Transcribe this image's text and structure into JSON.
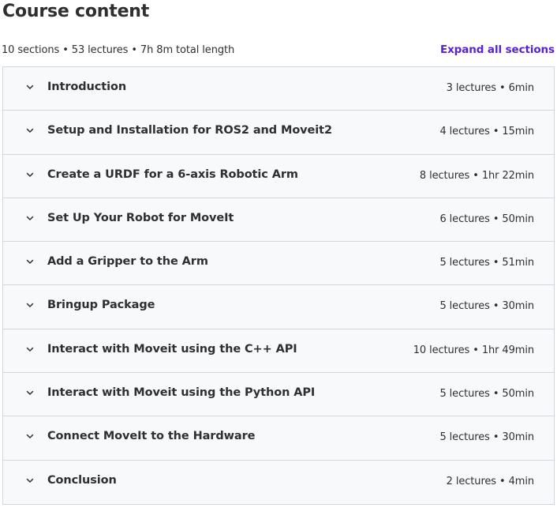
{
  "header": {
    "title": "Course content",
    "summary": "10 sections • 53 lectures • 7h 8m total length",
    "expand_label": "Expand all sections"
  },
  "sections": [
    {
      "title": "Introduction",
      "meta": "3 lectures • 6min",
      "icon": "chevron-down-icon"
    },
    {
      "title": "Setup and Installation for ROS2 and Moveit2",
      "meta": "4 lectures • 15min",
      "icon": "chevron-down-icon"
    },
    {
      "title": "Create a URDF for a 6-axis Robotic Arm",
      "meta": "8 lectures • 1hr 22min",
      "icon": "chevron-down-icon"
    },
    {
      "title": "Set Up Your Robot for MoveIt",
      "meta": "6 lectures • 50min",
      "icon": "chevron-down-icon"
    },
    {
      "title": "Add a Gripper to the Arm",
      "meta": "5 lectures • 51min",
      "icon": "chevron-down-icon"
    },
    {
      "title": "Bringup Package",
      "meta": "5 lectures • 30min",
      "icon": "chevron-down-icon"
    },
    {
      "title": "Interact with Moveit using the C++ API",
      "meta": "10 lectures • 1hr 49min",
      "icon": "chevron-down-icon"
    },
    {
      "title": "Interact with Moveit using the Python API",
      "meta": "5 lectures • 50min",
      "icon": "chevron-down-icon"
    },
    {
      "title": "Connect MoveIt to the Hardware",
      "meta": "5 lectures • 30min",
      "icon": "chevron-down-icon"
    },
    {
      "title": "Conclusion",
      "meta": "2 lectures • 4min",
      "icon": "chevron-down-icon"
    }
  ],
  "colors": {
    "accent": "#5624d0",
    "text": "#2d2f31",
    "row_background": "#f7f9fa",
    "border": "#d1d7dc"
  }
}
